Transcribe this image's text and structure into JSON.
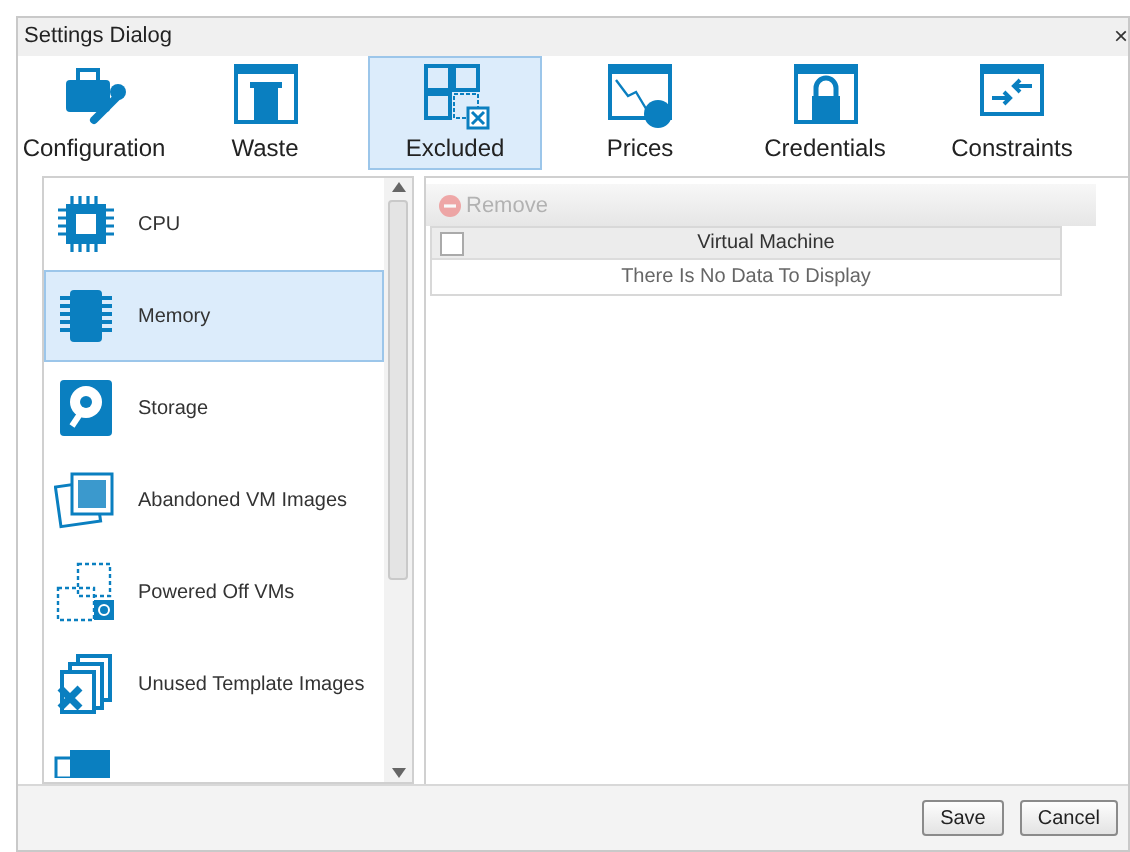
{
  "window": {
    "title": "Settings Dialog",
    "close": "×"
  },
  "tabs": [
    {
      "label": "Configuration",
      "selected": false
    },
    {
      "label": "Waste",
      "selected": false
    },
    {
      "label": "Excluded",
      "selected": true
    },
    {
      "label": "Prices",
      "selected": false
    },
    {
      "label": "Credentials",
      "selected": false
    },
    {
      "label": "Constraints",
      "selected": false
    }
  ],
  "sidebar": {
    "items": [
      {
        "label": "CPU",
        "selected": false
      },
      {
        "label": "Memory",
        "selected": true
      },
      {
        "label": "Storage",
        "selected": false
      },
      {
        "label": "Abandoned VM Images",
        "selected": false
      },
      {
        "label": "Powered Off VMs",
        "selected": false
      },
      {
        "label": "Unused Template Images",
        "selected": false
      }
    ]
  },
  "toolbar": {
    "remove": {
      "label": "Remove",
      "disabled": true
    }
  },
  "table": {
    "select_all": {
      "checked": false
    },
    "columns": [
      "Virtual Machine"
    ],
    "empty_text": "There Is No Data To Display"
  },
  "buttons": [
    "Save",
    "Cancel"
  ]
}
